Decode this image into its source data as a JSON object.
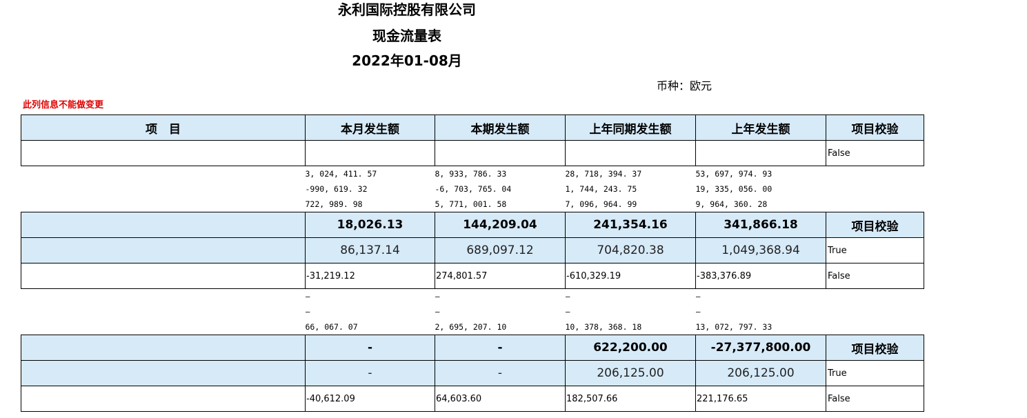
{
  "header": {
    "company": "永利国际控股有限公司",
    "report": "现金流量表",
    "period": "2022年01-08月",
    "currency": "币种：欧元",
    "warning": "此列信息不能做变更"
  },
  "columns": [
    "项　目",
    "本月发生额",
    "本期发生额",
    "上年同期发生额",
    "上年发生额",
    "项目校验"
  ],
  "rows": {
    "r1": {
      "item": "",
      "m": "",
      "p": "",
      "ly_p": "",
      "ly": "",
      "check": "False"
    },
    "s1": [
      [
        "3, 024, 411. 57",
        "8, 933, 786. 33",
        "28, 718, 394. 37",
        "53, 697, 974. 93"
      ],
      [
        "-990, 619. 32",
        "-6, 703, 765. 04",
        "1, 744, 243. 75",
        "19, 335, 056. 00"
      ],
      [
        "722, 989. 98",
        "5, 771, 001. 58",
        "7, 096, 964. 99",
        "9, 964, 360. 28"
      ]
    ],
    "r2": {
      "item": "",
      "m": "18,026.13",
      "p": "144,209.04",
      "ly_p": "241,354.16",
      "ly": "341,866.18",
      "check": "项目校验"
    },
    "r3": {
      "item": "",
      "m": "86,137.14",
      "p": "689,097.12",
      "ly_p": "704,820.38",
      "ly": "1,049,368.94",
      "check": "True"
    },
    "r4": {
      "item": "",
      "m": "-31,219.12",
      "p": "274,801.57",
      "ly_p": "-610,329.19",
      "ly": "-383,376.89",
      "check": "False"
    },
    "s2": [
      [
        "–",
        "–",
        "–",
        "–"
      ],
      [
        "–",
        "–",
        "–",
        "–"
      ],
      [
        "66, 067. 07",
        "2, 695, 207. 10",
        "10, 378, 368. 18",
        "13, 072, 797. 33"
      ]
    ],
    "r5": {
      "item": "",
      "m": "-",
      "p": "-",
      "ly_p": "622,200.00",
      "ly": "-27,377,800.00",
      "check": "项目校验"
    },
    "r6": {
      "item": "",
      "m": "-",
      "p": "-",
      "ly_p": "206,125.00",
      "ly": "206,125.00",
      "check": "True"
    },
    "r7": {
      "item": "",
      "m": "-40,612.09",
      "p": "64,603.60",
      "ly_p": "182,507.66",
      "ly": "221,176.65",
      "check": "False"
    }
  }
}
